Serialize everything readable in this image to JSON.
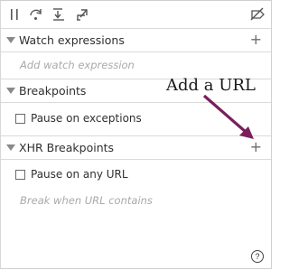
{
  "toolbar": {
    "icons": [
      "pause-icon",
      "step-over-icon",
      "step-into-icon",
      "step-out-icon",
      "deactivate-breakpoints-icon"
    ]
  },
  "watch": {
    "title": "Watch expressions",
    "placeholder": "Add watch expression"
  },
  "breakpoints": {
    "title": "Breakpoints",
    "pause_on_exceptions": "Pause on exceptions"
  },
  "xhr": {
    "title": "XHR Breakpoints",
    "pause_on_any_url": "Pause on any URL",
    "placeholder": "Break when URL contains"
  },
  "annotation": {
    "text": "Add a URL",
    "arrow_color": "#7a1f5c"
  },
  "help": {
    "label": "?"
  },
  "plus_label": "+"
}
